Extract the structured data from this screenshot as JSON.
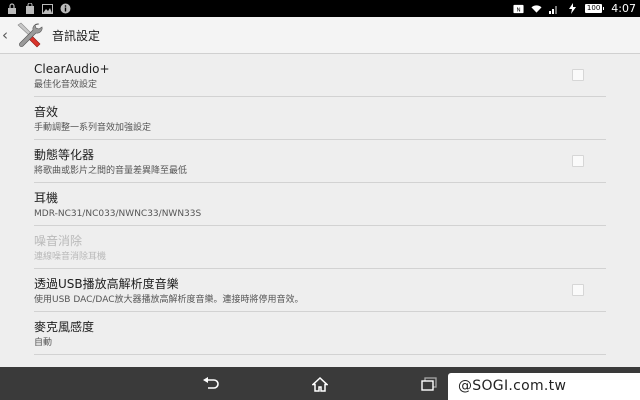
{
  "status_bar": {
    "time": "4:07",
    "battery": "100",
    "left_icons": [
      "lock-icon",
      "bag-icon",
      "image-icon",
      "info-icon"
    ],
    "right_icons": [
      "nfc-icon",
      "wifi-icon",
      "signal-icon",
      "charging-icon"
    ]
  },
  "action_bar": {
    "title": "音訊設定",
    "icon": "tools-icon"
  },
  "settings": [
    {
      "title": "ClearAudio+",
      "subtitle": "最佳化音效設定",
      "checkbox": true,
      "enabled": true
    },
    {
      "title": "音效",
      "subtitle": "手動調整一系列音效加強設定",
      "checkbox": false,
      "enabled": true
    },
    {
      "title": "動態等化器",
      "subtitle": "將歌曲或影片之間的音量差異降至最低",
      "checkbox": true,
      "enabled": true
    },
    {
      "title": "耳機",
      "subtitle": "MDR-NC31/NC033/NWNC33/NWN33S",
      "checkbox": false,
      "enabled": true
    },
    {
      "title": "噪音消除",
      "subtitle": "連線噪音消除耳機",
      "checkbox": false,
      "enabled": false
    },
    {
      "title": "透過USB播放高解析度音樂",
      "subtitle": "使用USB DAC/DAC放大器播放高解析度音樂。連接時將停用音效。",
      "checkbox": true,
      "enabled": true
    },
    {
      "title": "麥克風感度",
      "subtitle": "自動",
      "checkbox": false,
      "enabled": true
    }
  ],
  "nav_bar": {
    "buttons": [
      "back-icon",
      "home-icon",
      "recent-apps-icon"
    ]
  },
  "watermark": "@SOGI.com.tw"
}
